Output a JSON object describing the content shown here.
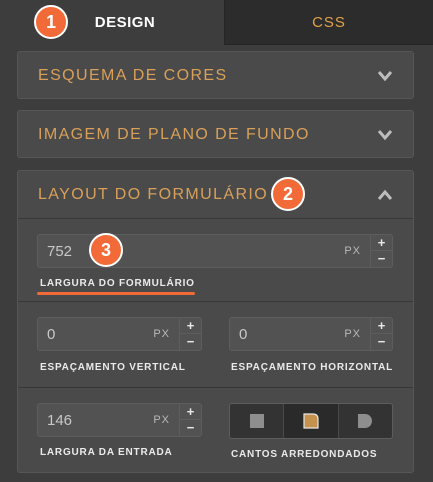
{
  "tabs": [
    {
      "label": "DESIGN"
    },
    {
      "label": "CSS"
    }
  ],
  "badges": [
    "1",
    "2",
    "3"
  ],
  "sections": [
    {
      "title": "ESQUEMA DE CORES",
      "state": "collapsed"
    },
    {
      "title": "IMAGEM DE PLANO DE FUNDO",
      "state": "collapsed"
    },
    {
      "title": "LAYOUT DO FORMULÁRIO",
      "state": "expanded"
    }
  ],
  "form_layout": {
    "form_width": {
      "value": "752",
      "unit": "PX",
      "label": "LARGURA DO FORMULÁRIO"
    },
    "vertical_spacing": {
      "value": "0",
      "unit": "PX",
      "label": "ESPAÇAMENTO VERTICAL"
    },
    "horizontal_spacing": {
      "value": "0",
      "unit": "PX",
      "label": "ESPAÇAMENTO HORIZONTAL"
    },
    "input_width": {
      "value": "146",
      "unit": "PX",
      "label": "LARGURA DA ENTRADA"
    },
    "rounded_corners": {
      "label": "CANTOS ARREDONDADOS",
      "options": [
        "square",
        "rounded",
        "pill"
      ],
      "selected": "rounded"
    }
  },
  "stepper": {
    "plus": "+",
    "minus": "−"
  },
  "colors": {
    "accent": "#f26a38",
    "section_title": "#d8a059",
    "panel_bg": "#3d3d3d"
  }
}
